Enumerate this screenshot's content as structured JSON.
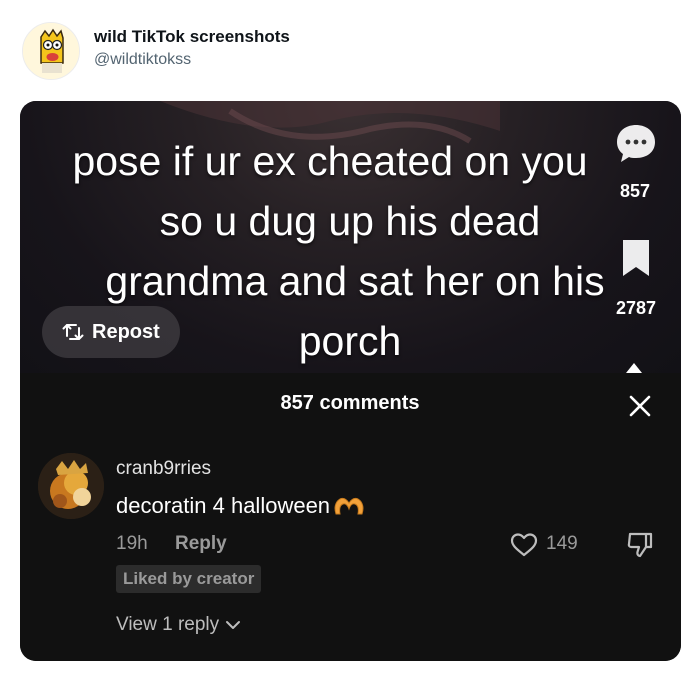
{
  "tweet": {
    "author_name": "wild TikTok screenshots",
    "author_handle": "@wildtiktokss",
    "avatar_icon": "cartoon-character-avatar"
  },
  "video": {
    "caption_lines": [
      "pose if ur ex cheated on you",
      "so u dug up his dead",
      "grandma and sat her on his",
      "porch"
    ],
    "repost_label": "Repost",
    "repost_icon": "repost-arrows-icon",
    "side_comment_count": "857",
    "side_save_count": "2787"
  },
  "comments": {
    "header_title": "857 comments",
    "close_icon": "close-icon",
    "items": [
      {
        "username": "cranb9rries",
        "text": "decoratin 4 halloween",
        "emoji_icon": "heart-hands-icon",
        "time": "19h",
        "reply_label": "Reply",
        "liked_by_creator": "Liked by creator",
        "like_count": "149",
        "view_replies": "View 1 reply"
      }
    ]
  },
  "colors": {
    "panel_background": "#111111",
    "text_primary": "#ffffff",
    "text_muted": "#9a9a9a",
    "emoji_orange": "#f2a13a"
  }
}
